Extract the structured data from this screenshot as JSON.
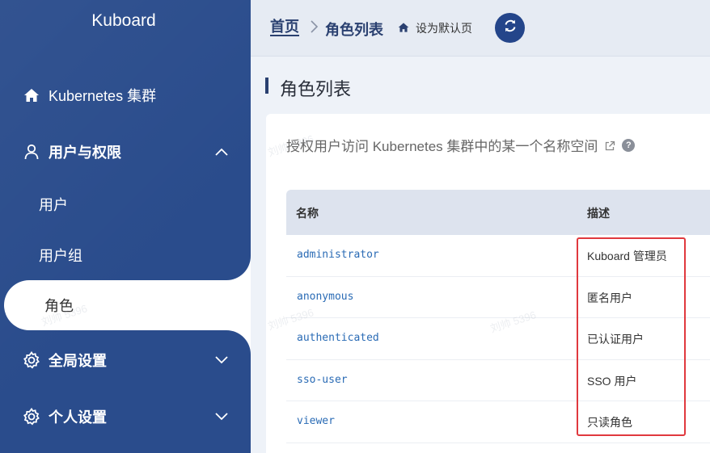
{
  "sidebar": {
    "brand": "Kuboard",
    "items": [
      {
        "label": "Kubernetes 集群",
        "icon": "home-icon"
      },
      {
        "label": "用户与权限",
        "icon": "user-icon",
        "expanded": true,
        "children": [
          {
            "label": "用户"
          },
          {
            "label": "用户组"
          },
          {
            "label": "角色",
            "active": true
          }
        ]
      },
      {
        "label": "全局设置",
        "icon": "gear-icon"
      },
      {
        "label": "个人设置",
        "icon": "gear-icon"
      }
    ]
  },
  "header": {
    "breadcrumb_home": "首页",
    "breadcrumb_current": "角色列表",
    "set_default": "设为默认页",
    "refresh_icon": "refresh-icon"
  },
  "main": {
    "title": "角色列表",
    "description": "授权用户访问 Kubernetes 集群中的某一个名称空间",
    "help_glyph": "?",
    "table": {
      "columns": [
        "名称",
        "描述"
      ],
      "rows": [
        {
          "name": "administrator",
          "desc": "Kuboard 管理员"
        },
        {
          "name": "anonymous",
          "desc": "匿名用户"
        },
        {
          "name": "authenticated",
          "desc": "已认证用户"
        },
        {
          "name": "sso-user",
          "desc": "SSO 用户"
        },
        {
          "name": "viewer",
          "desc": "只读角色"
        }
      ]
    }
  },
  "watermark": "刘帅 5396",
  "colors": {
    "sidebar_bg": "#2a4c8c",
    "accent": "#24458a",
    "link": "#2a6bb5",
    "highlight": "#e0393e"
  }
}
